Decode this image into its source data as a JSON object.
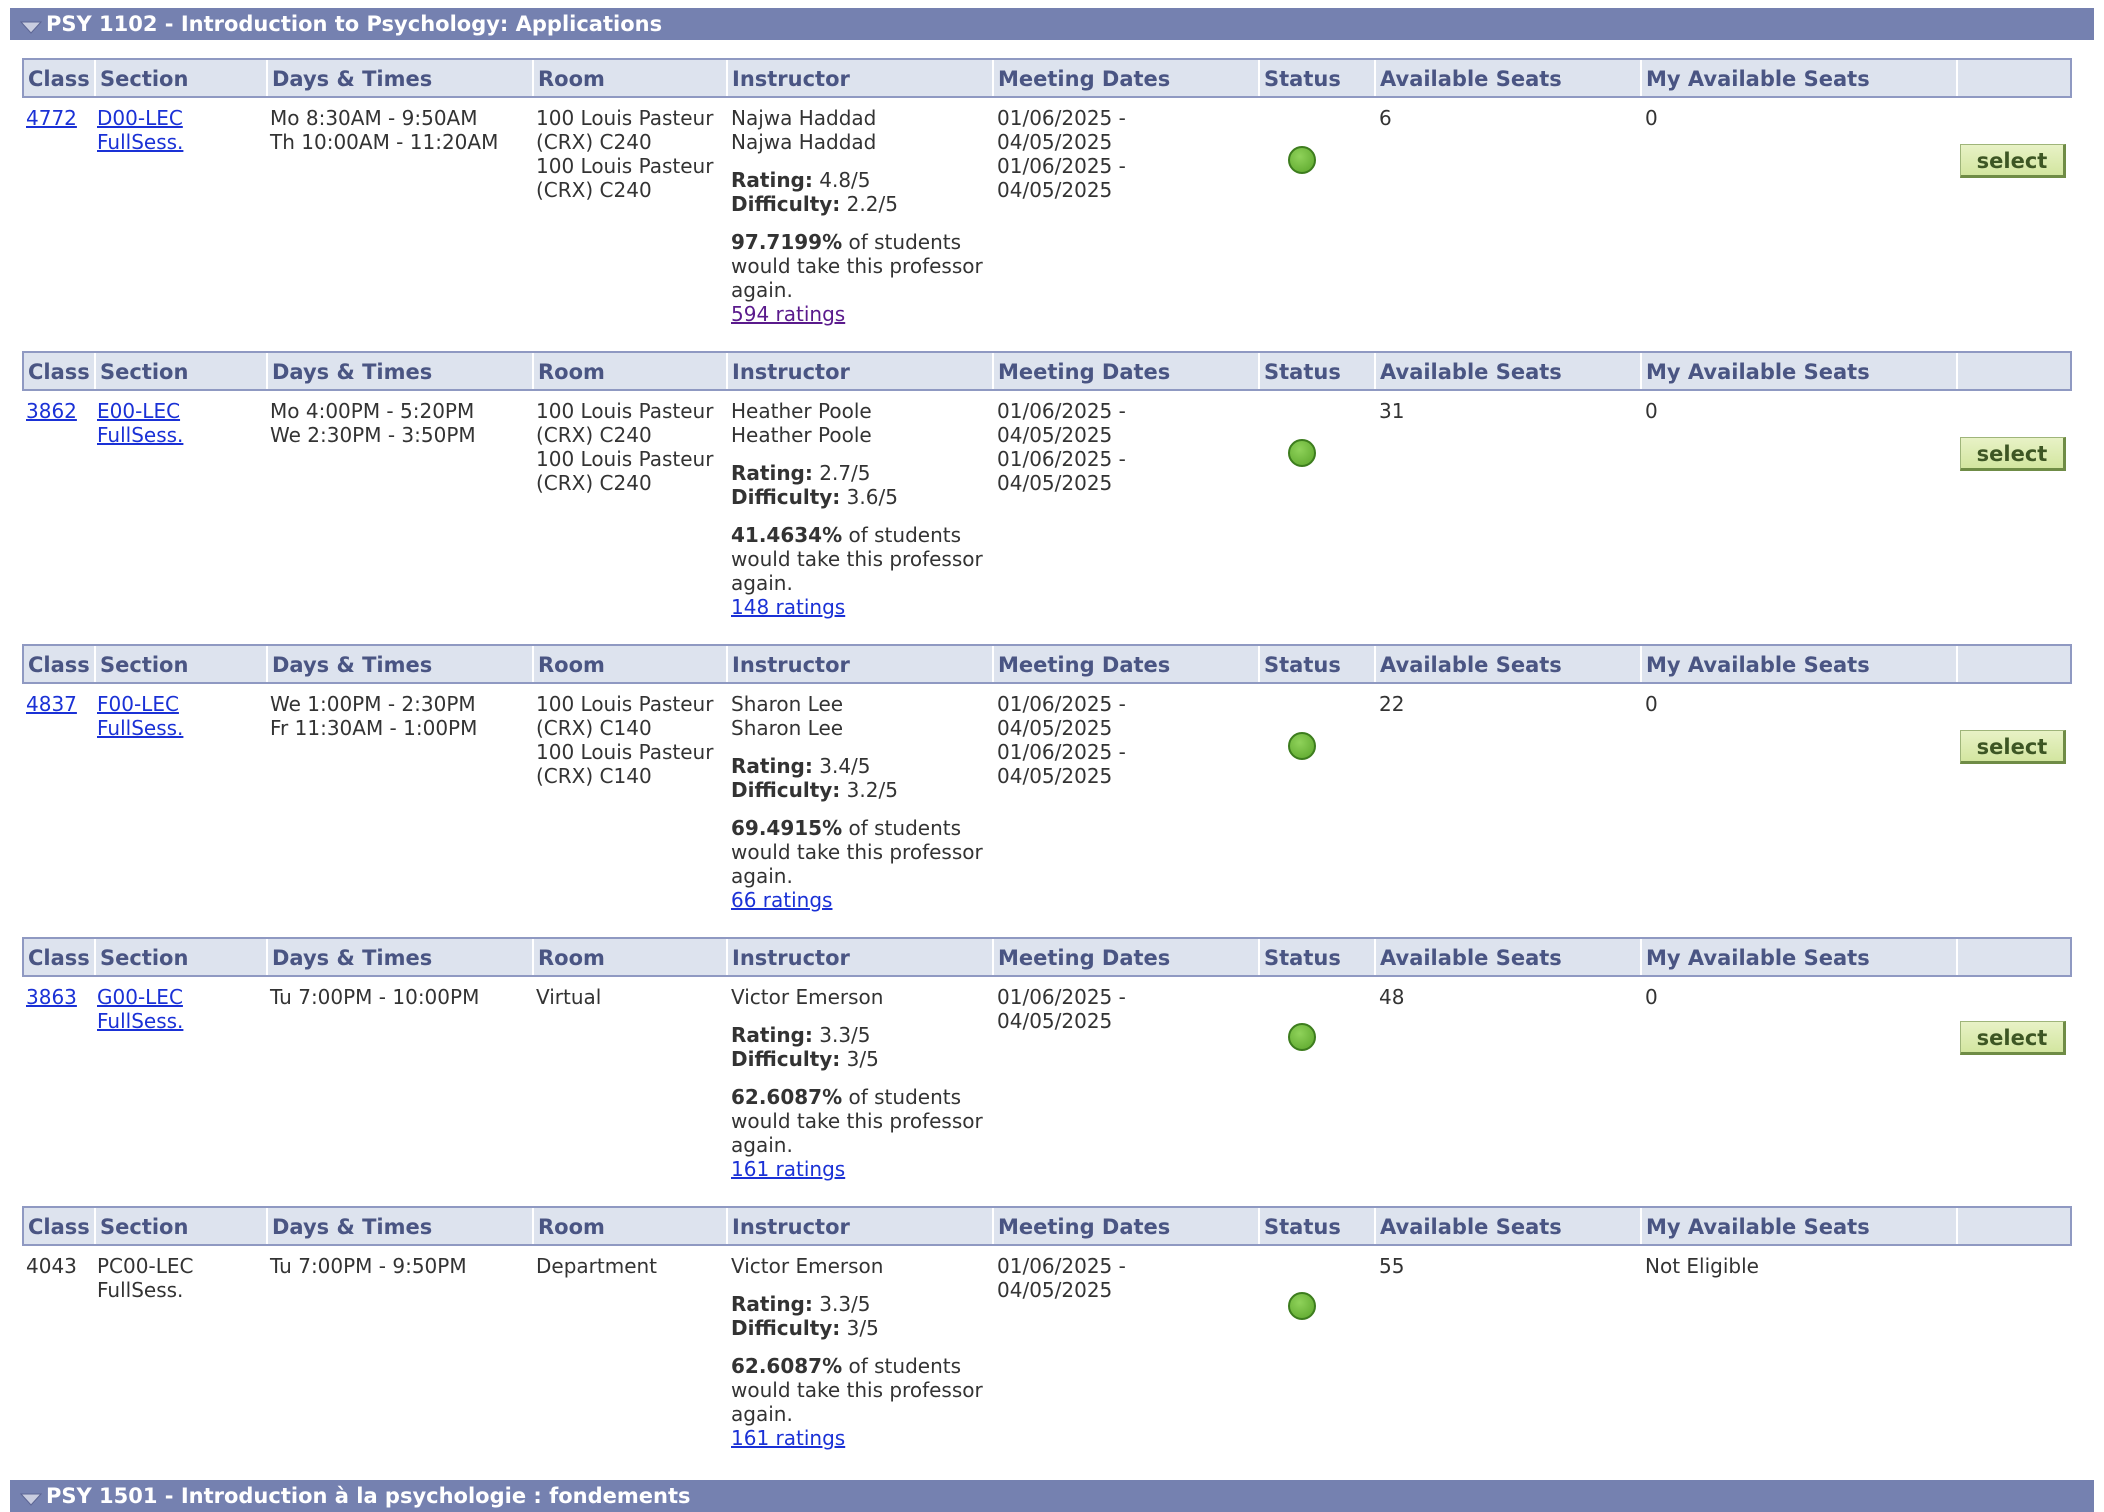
{
  "courses": [
    {
      "title": "PSY 1102 - Introduction to Psychology: Applications"
    },
    {
      "title": "PSY 1501 - Introduction à la psychologie : fondements"
    }
  ],
  "headers": {
    "class": "Class",
    "section": "Section",
    "days_times": "Days & Times",
    "room": "Room",
    "instructor": "Instructor",
    "meeting_dates": "Meeting Dates",
    "status": "Status",
    "available_seats": "Available Seats",
    "my_available_seats": "My Available Seats"
  },
  "labels": {
    "rating": "Rating:",
    "difficulty": "Difficulty:",
    "take_again_suffix": " of students would take this professor again.",
    "select": "select"
  },
  "sections": [
    {
      "class_nbr": "4772",
      "section": "D00-LEC",
      "session": "FullSess.",
      "times": [
        "Mo 8:30AM - 9:50AM",
        "Th 10:00AM - 11:20AM"
      ],
      "rooms": [
        "100 Louis Pasteur (CRX) C240",
        "100 Louis Pasteur (CRX) C240"
      ],
      "instructors": [
        "Najwa Haddad",
        "Najwa Haddad"
      ],
      "rating": "4.8/5",
      "difficulty": "2.2/5",
      "take_again": "97.7199%",
      "ratings_link": "594 ratings",
      "dates": [
        "01/06/2025 - 04/05/2025",
        "01/06/2025 - 04/05/2025"
      ],
      "status": "open",
      "available_seats": "6",
      "my_available_seats": "0"
    },
    {
      "class_nbr": "3862",
      "section": "E00-LEC",
      "session": "FullSess.",
      "times": [
        "Mo 4:00PM - 5:20PM",
        "We 2:30PM - 3:50PM"
      ],
      "rooms": [
        "100 Louis Pasteur (CRX) C240",
        "100 Louis Pasteur (CRX) C240"
      ],
      "instructors": [
        "Heather Poole",
        "Heather Poole"
      ],
      "rating": "2.7/5",
      "difficulty": "3.6/5",
      "take_again": "41.4634%",
      "ratings_link": "148 ratings",
      "dates": [
        "01/06/2025 - 04/05/2025",
        "01/06/2025 - 04/05/2025"
      ],
      "status": "open",
      "available_seats": "31",
      "my_available_seats": "0"
    },
    {
      "class_nbr": "4837",
      "section": "F00-LEC",
      "session": "FullSess.",
      "times": [
        "We 1:00PM - 2:30PM",
        "Fr 11:30AM - 1:00PM"
      ],
      "rooms": [
        "100 Louis Pasteur (CRX) C140",
        "100 Louis Pasteur (CRX) C140"
      ],
      "instructors": [
        "Sharon Lee",
        "Sharon Lee"
      ],
      "rating": "3.4/5",
      "difficulty": "3.2/5",
      "take_again": "69.4915%",
      "ratings_link": "66 ratings",
      "dates": [
        "01/06/2025 - 04/05/2025",
        "01/06/2025 - 04/05/2025"
      ],
      "status": "open",
      "available_seats": "22",
      "my_available_seats": "0"
    },
    {
      "class_nbr": "3863",
      "section": "G00-LEC",
      "session": "FullSess.",
      "times": [
        "Tu 7:00PM - 10:00PM"
      ],
      "rooms": [
        "Virtual"
      ],
      "instructors": [
        "Victor Emerson"
      ],
      "rating": "3.3/5",
      "difficulty": "3/5",
      "take_again": "62.6087%",
      "ratings_link": "161 ratings",
      "dates": [
        "01/06/2025 - 04/05/2025"
      ],
      "status": "open",
      "available_seats": "48",
      "my_available_seats": "0"
    },
    {
      "class_nbr": "4043",
      "section": "PC00-LEC",
      "session": "FullSess.",
      "times": [
        "Tu 7:00PM - 9:50PM"
      ],
      "rooms": [
        "Department"
      ],
      "instructors": [
        "Victor Emerson"
      ],
      "rating": "3.3/5",
      "difficulty": "3/5",
      "take_again": "62.6087%",
      "ratings_link": "161 ratings",
      "dates": [
        "01/06/2025 - 04/05/2025"
      ],
      "status": "open",
      "available_seats": "55",
      "my_available_seats": "Not Eligible"
    }
  ],
  "colors": {
    "header_bar": "#7581b0",
    "table_header_bg": "#dde3ee",
    "header_text": "#4a5583",
    "link": "#1a31d6",
    "visited_link": "#5a1a8c",
    "status_open": "#6cbb3c",
    "select_button": "#d9e9ae"
  }
}
